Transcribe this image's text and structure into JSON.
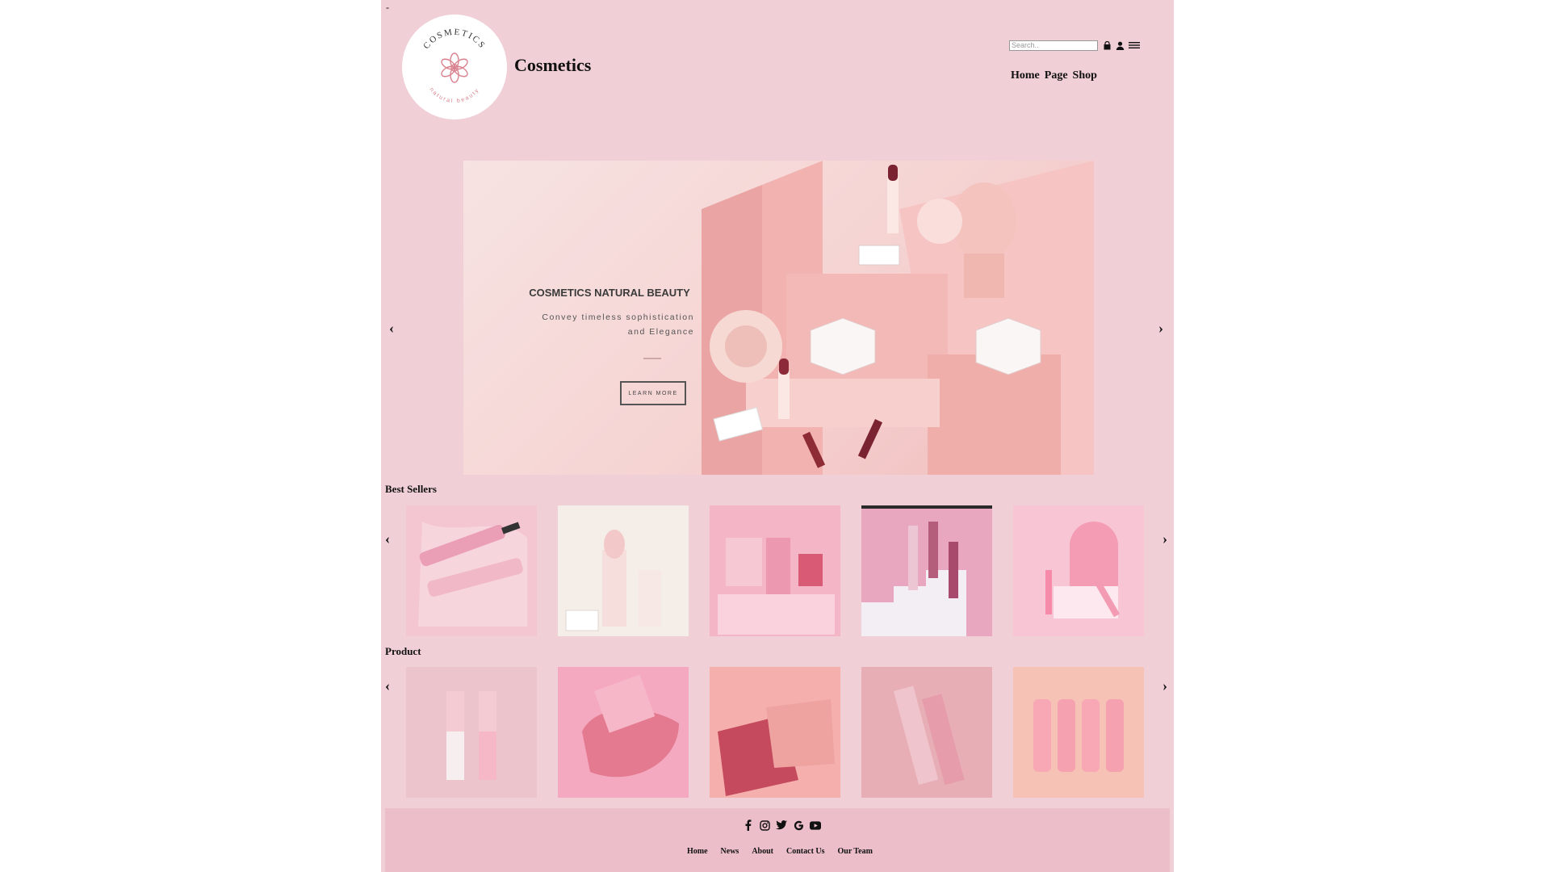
{
  "page_marker": "-",
  "header": {
    "brand": "Cosmetics",
    "logo_text_top": "COSMETICS",
    "logo_text_bottom": "natural beauty",
    "search_placeholder": "Search..",
    "nav": [
      "Home",
      "Page",
      "Shop"
    ],
    "icons": [
      "bag-icon",
      "user-icon",
      "menu-icon"
    ]
  },
  "hero": {
    "title": "COSMETICS NATURAL BEAUTY",
    "subtitle_line1": "Convey timeless sophistication",
    "subtitle_line2": "and Elegance",
    "button": "LEARN MORE",
    "prev": "‹",
    "next": "›"
  },
  "best_sellers": {
    "title": "Best Sellers",
    "prev": "‹",
    "next": "›",
    "items": [
      "mascara-swatch",
      "lipstick-cream",
      "kylie-palette-boxes",
      "lip-gloss-trio",
      "pink-cosmetic-set"
    ]
  },
  "products": {
    "title": "Product",
    "prev": "‹",
    "next": "›",
    "items": [
      "lip-oil-duo",
      "kylie-blush",
      "eyeshadow-palettes",
      "kylie-lip-kit",
      "lip-tubes"
    ]
  },
  "footer": {
    "social_icons": [
      "facebook-icon",
      "instagram-icon",
      "twitter-icon",
      "google-icon",
      "youtube-icon"
    ],
    "links": [
      "Home",
      "News",
      "About",
      "Contact Us",
      "Our Team"
    ]
  },
  "colors": {
    "page_bg": "#f0cfd6",
    "footer_bg": "#ebbec9",
    "accent": "#d9828e"
  }
}
